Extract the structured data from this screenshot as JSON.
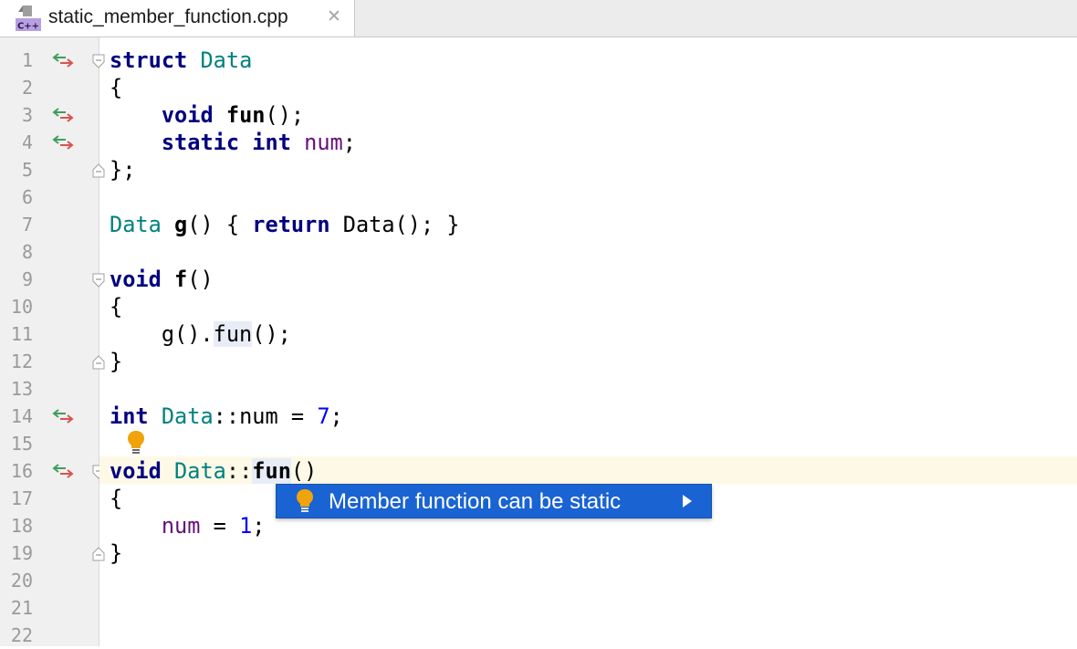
{
  "tab": {
    "file_name": "static_member_function.cpp",
    "file_icon_label": "C++",
    "close_glyph": "✕"
  },
  "gutter": {
    "line_numbers": [
      "1",
      "2",
      "3",
      "4",
      "5",
      "6",
      "7",
      "8",
      "9",
      "10",
      "11",
      "12",
      "13",
      "14",
      "15",
      "16",
      "17",
      "18",
      "19",
      "20",
      "21",
      "22"
    ]
  },
  "code": {
    "lines": [
      "struct Data",
      "{",
      "    void fun();",
      "    static int num;",
      "};",
      "",
      "Data g() { return Data(); }",
      "",
      "void f()",
      "{",
      "    g().fun();",
      "}",
      "",
      "int Data::num = 7;",
      "",
      "void Data::fun()",
      "{",
      "    num = 1;",
      "}",
      "",
      "",
      ""
    ],
    "current_line": 16,
    "tokens": {
      "line1": {
        "kw": "struct",
        "type": "Data"
      },
      "line2": {
        "punct": "{"
      },
      "line3": {
        "kw": "void",
        "fn": "fun",
        "rest": "();"
      },
      "line4": {
        "kw1": "static",
        "kw2": "int",
        "field": "num",
        "rest": ";"
      },
      "line5": {
        "punct": "};"
      },
      "line7": {
        "type": "Data",
        "fn": "g",
        "mid": "() { ",
        "kw": "return",
        "tail": " Data(); }"
      },
      "line9": {
        "kw": "void",
        "fn": "f",
        "rest": "()"
      },
      "line10": {
        "punct": "{"
      },
      "line11": {
        "pre": "    g().",
        "call": "fun",
        "rest": "();"
      },
      "line12": {
        "punct": "}"
      },
      "line14": {
        "kw": "int",
        "type": "Data",
        "mid": "::num = ",
        "num": "7",
        "rest": ";"
      },
      "line16": {
        "kw": "void",
        "type": "Data",
        "sep": "::",
        "fn": "fun",
        "rest": "()"
      },
      "line17": {
        "punct": "{"
      },
      "line18": {
        "field": "num",
        "mid": " = ",
        "num": "1",
        "rest": ";"
      },
      "line19": {
        "punct": "}"
      }
    }
  },
  "popup": {
    "label": "Member function can be static"
  },
  "colors": {
    "keyword": "#000080",
    "type": "#008080",
    "field": "#660e7a",
    "number": "#0000ff",
    "popup_bg": "#1a63d3",
    "bulb": "#f0a30a",
    "impl_arrow_green": "#3f9e5a",
    "impl_arrow_red": "#d9534f"
  },
  "icons": {
    "gutter_marker": "override-implement-arrows-icon",
    "intention": "lightbulb-icon",
    "submenu": "triangle-right-icon",
    "fold": "fold-marker-icon"
  }
}
